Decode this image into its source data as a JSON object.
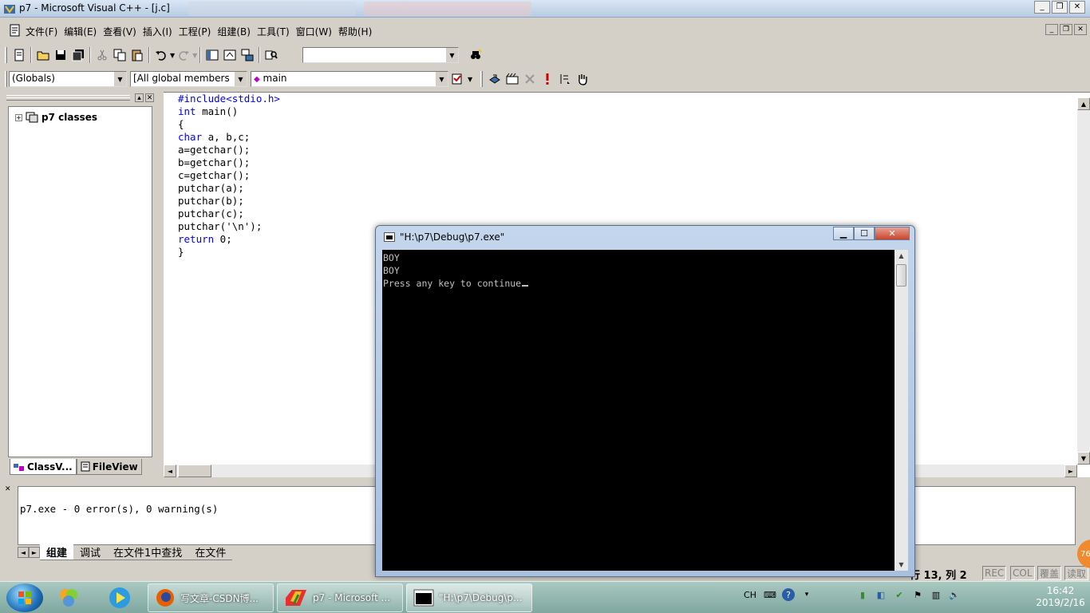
{
  "window": {
    "title": "p7 - Microsoft Visual C++ - [j.c]",
    "controls": [
      "minimize",
      "restore",
      "close"
    ]
  },
  "menu": {
    "items": [
      "文件(F)",
      "编辑(E)",
      "查看(V)",
      "插入(I)",
      "工程(P)",
      "组建(B)",
      "工具(T)",
      "窗口(W)",
      "帮助(H)"
    ]
  },
  "toolbar": {
    "find_combo_value": "",
    "globals_combo": "(Globals)",
    "members_combo": "[All global members",
    "function_combo": "main"
  },
  "workspace": {
    "tree_root": "p7 classes",
    "tabs": [
      "ClassV...",
      "FileView"
    ]
  },
  "editor": {
    "code_lines": [
      "#include<stdio.h>",
      "int main()",
      "{",
      "char a, b,c;",
      "a=getchar();",
      "b=getchar();",
      "c=getchar();",
      "putchar(a);",
      "putchar(b);",
      "putchar(c);",
      "putchar('\\n');",
      "return 0;",
      "}"
    ]
  },
  "output": {
    "message": "p7.exe - 0 error(s), 0 warning(s)",
    "tabs": [
      "组建",
      "调试",
      "在文件1中查找",
      "在文件"
    ]
  },
  "statusbar": {
    "position": "行 13, 列 2",
    "indicators": [
      "REC",
      "COL",
      "覆盖",
      "读取"
    ]
  },
  "console": {
    "title": "\"H:\\p7\\Debug\\p7.exe\"",
    "lines": [
      "BOY",
      "BOY",
      "Press any key to continue"
    ]
  },
  "taskbar": {
    "tasks": [
      "写文章-CSDN博...",
      "p7 - Microsoft ...",
      "\"H:\\p7\\Debug\\p..."
    ],
    "tray_lang": "CH",
    "clock_time": "16:42",
    "clock_date": "2019/2/16",
    "notification_badge": "76"
  },
  "colors": {
    "keyword": "#0000ff",
    "console_bg": "#000000",
    "console_text": "#c0c0c0",
    "chrome": "#d4d0c8"
  }
}
